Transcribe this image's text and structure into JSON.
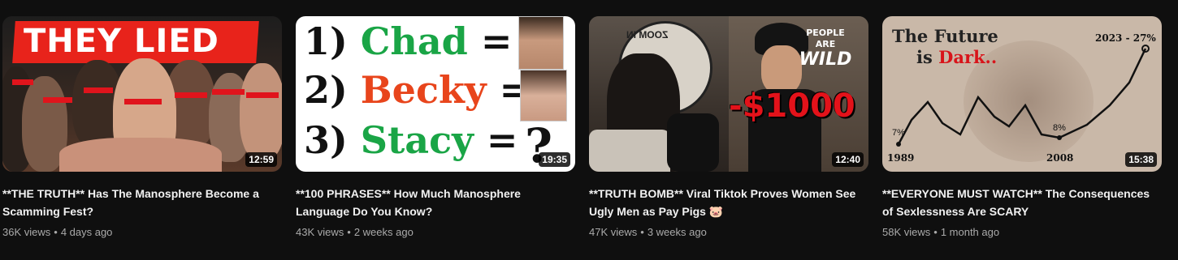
{
  "videos": [
    {
      "title": "**THE TRUTH** Has The Manosphere Become a Scamming Fest?",
      "views": "36K views",
      "age": "4 days ago",
      "duration": "12:59",
      "thumb_text": "THEY LIED"
    },
    {
      "title": "**100 PHRASES** How Much Manosphere Language Do You Know?",
      "views": "43K views",
      "age": "2 weeks ago",
      "duration": "19:35",
      "thumb_lines": [
        {
          "num": "1)",
          "word": "Chad",
          "eq": "=",
          "color": "#1aa546"
        },
        {
          "num": "2)",
          "word": "Becky",
          "eq": "=",
          "color": "#e8451c"
        },
        {
          "num": "3)",
          "word": "Stacy",
          "eq": "=",
          "color": "#1aa546"
        }
      ],
      "question_mark": "?"
    },
    {
      "title": "**TRUTH BOMB** Viral Tiktok Proves Women See Ugly Men as Pay Pigs 🐷",
      "views": "47K views",
      "age": "3 weeks ago",
      "duration": "12:40",
      "thumb_badge_line1": "PEOPLE ARE",
      "thumb_badge_line2": "WILD",
      "thumb_amount": "-$1000",
      "mirror_text": "ZOOM IN"
    },
    {
      "title": "**EVERYONE MUST WATCH** The Consequences of Sexlessness Are SCARY",
      "views": "58K views",
      "age": "1 month ago",
      "duration": "15:38",
      "thumb_title_1": "The Future",
      "thumb_title_2a": "is ",
      "thumb_title_2b": "Dark..",
      "label_start_pct": "7%",
      "label_start_year": "1989",
      "label_mid_pct": "8%",
      "label_mid_year": "2008",
      "label_end": "2023 - 27%"
    }
  ],
  "colors": {
    "background": "#0f0f0f",
    "title": "#f1f1f1",
    "meta": "#aaaaaa",
    "accent_red": "#e0141c"
  }
}
